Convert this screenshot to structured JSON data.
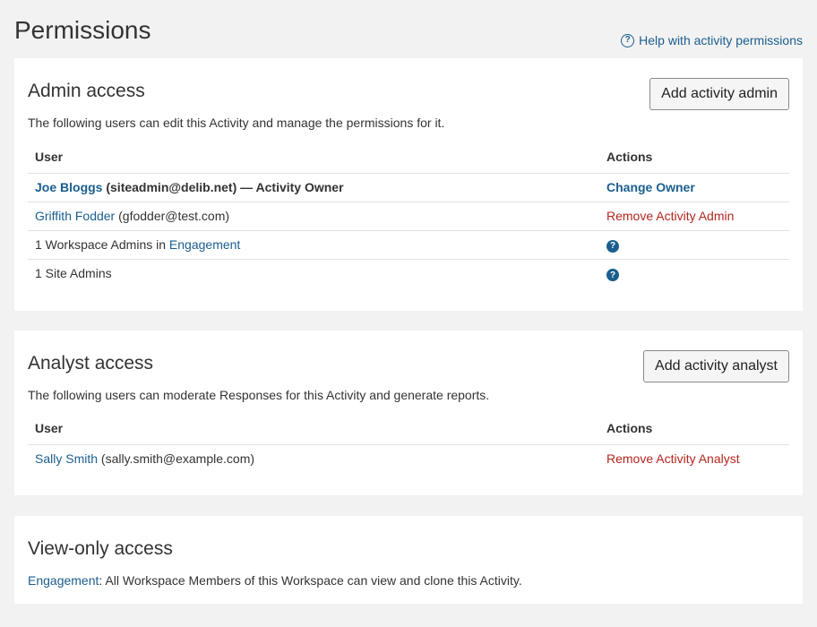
{
  "page": {
    "title": "Permissions",
    "help_link": "Help with activity permissions"
  },
  "admin": {
    "title": "Admin access",
    "add_button": "Add activity admin",
    "description": "The following users can edit this Activity and manage the permissions for it.",
    "headers": {
      "user": "User",
      "actions": "Actions"
    },
    "rows": [
      {
        "name": "Joe Bloggs",
        "detail": " (siteadmin@delib.net) — Activity Owner",
        "action": "Change Owner"
      },
      {
        "name": "Griffith Fodder",
        "detail": " (gfodder@test.com)",
        "action": "Remove Activity Admin"
      },
      {
        "prefix": "1 Workspace Admins in ",
        "link": "Engagement",
        "icon": "question-circle-icon"
      },
      {
        "text": "1 Site Admins",
        "icon": "question-circle-icon"
      }
    ]
  },
  "analyst": {
    "title": "Analyst access",
    "add_button": "Add activity analyst",
    "description": "The following users can moderate Responses for this Activity and generate reports.",
    "headers": {
      "user": "User",
      "actions": "Actions"
    },
    "rows": [
      {
        "name": "Sally Smith",
        "detail": " (sally.smith@example.com)",
        "action": "Remove Activity Analyst"
      }
    ]
  },
  "viewonly": {
    "title": "View-only access",
    "link": "Engagement",
    "text": ": All Workspace Members of this Workspace can view and clone this Activity."
  },
  "colors": {
    "link": "#1a5e8f",
    "danger": "#b3261e",
    "background": "#f2f2f2"
  }
}
